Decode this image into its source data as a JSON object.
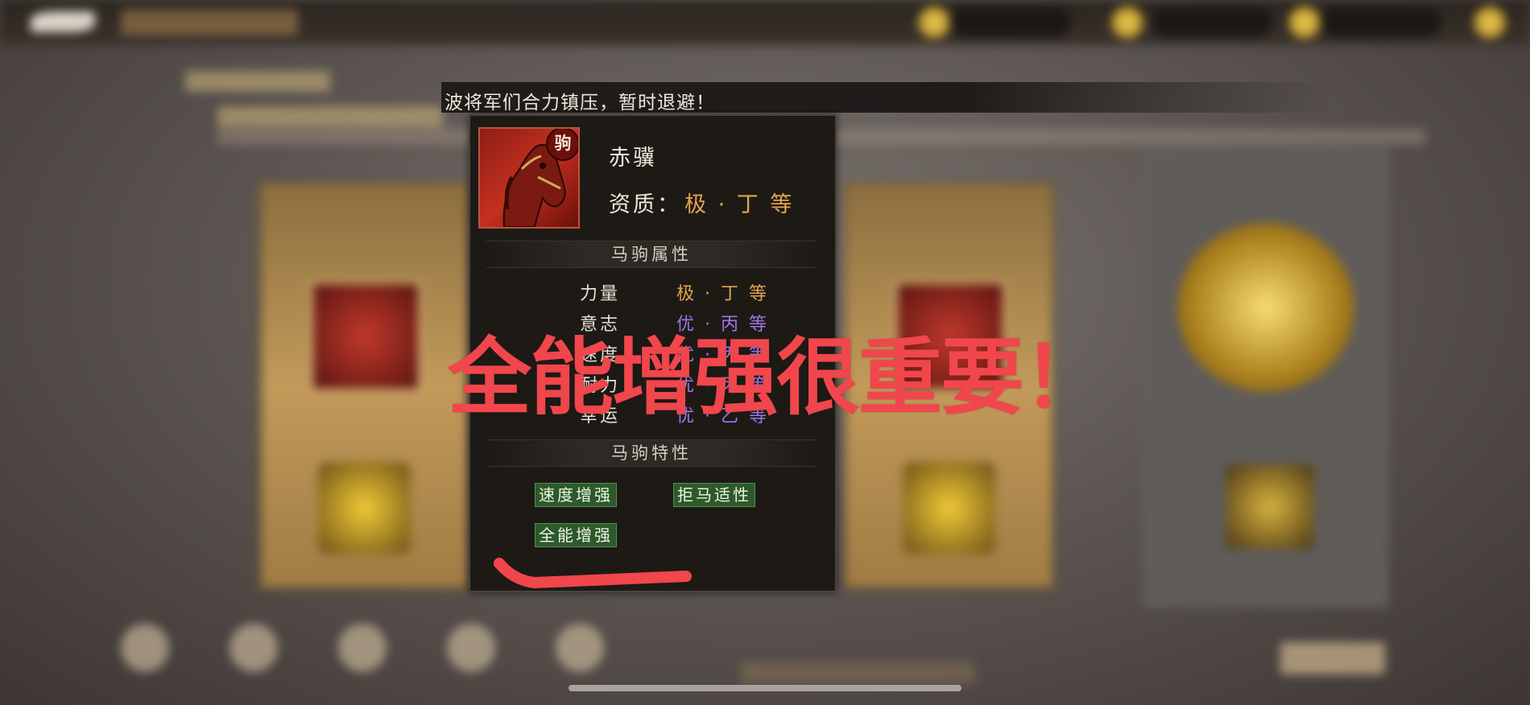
{
  "notice": {
    "text": "波将军们合力镇压，暂时退避！"
  },
  "horse": {
    "tag": "驹",
    "name": "赤骥",
    "quality_label": "资质：",
    "quality_value": "极 · 丁 等"
  },
  "attributes_section": {
    "title": "马驹属性",
    "items": [
      {
        "name": "力量",
        "value": "极 · 丁 等",
        "color": "#e3a34e"
      },
      {
        "name": "意志",
        "value": "优 · 丙 等",
        "color": "#9e75e6"
      },
      {
        "name": "速度",
        "value": "优 · 丙 等",
        "color": "#9e75e6"
      },
      {
        "name": "耐力",
        "value": "优 · 丙 等",
        "color": "#9e75e6"
      },
      {
        "name": "幸运",
        "value": "优 · 乙 等",
        "color": "#9e75e6"
      }
    ]
  },
  "traits_section": {
    "title": "马驹特性",
    "items": [
      "速度增强",
      "拒马适性",
      "全能增强"
    ]
  },
  "annotation": {
    "text": "全能增强很重要！",
    "color": "#f0464c"
  }
}
